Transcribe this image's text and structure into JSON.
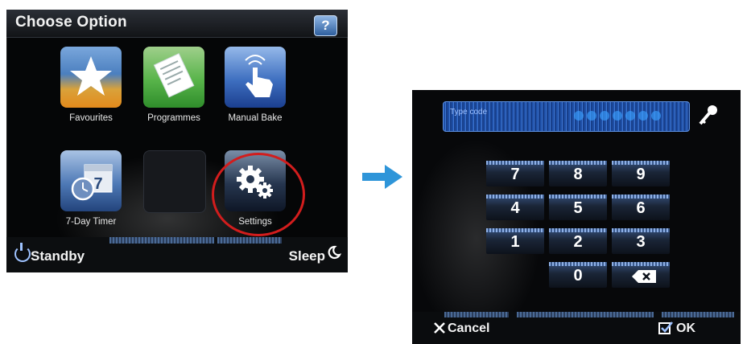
{
  "menu_screen": {
    "title": "Choose Option",
    "help_label": "?",
    "tiles": [
      {
        "label": "Favourites",
        "icon": "star-icon"
      },
      {
        "label": "Programmes",
        "icon": "document-icon"
      },
      {
        "label": "Manual Bake",
        "icon": "touch-hand-icon"
      },
      {
        "label": "7-Day Timer",
        "icon": "calendar-clock-icon"
      },
      {
        "label": "",
        "icon": "empty"
      },
      {
        "label": "Settings",
        "icon": "gears-icon"
      }
    ],
    "highlight_color": "#d21d1d",
    "standby_label": "Standby",
    "sleep_label": "Sleep"
  },
  "transition_arrow_color": "#2e95d9",
  "pin_screen": {
    "field_placeholder": "Type code",
    "keys": [
      "7",
      "8",
      "9",
      "4",
      "5",
      "6",
      "1",
      "2",
      "3",
      "0"
    ],
    "backspace_icon": "backspace-icon",
    "cancel_label": "Cancel",
    "ok_label": "OK"
  }
}
